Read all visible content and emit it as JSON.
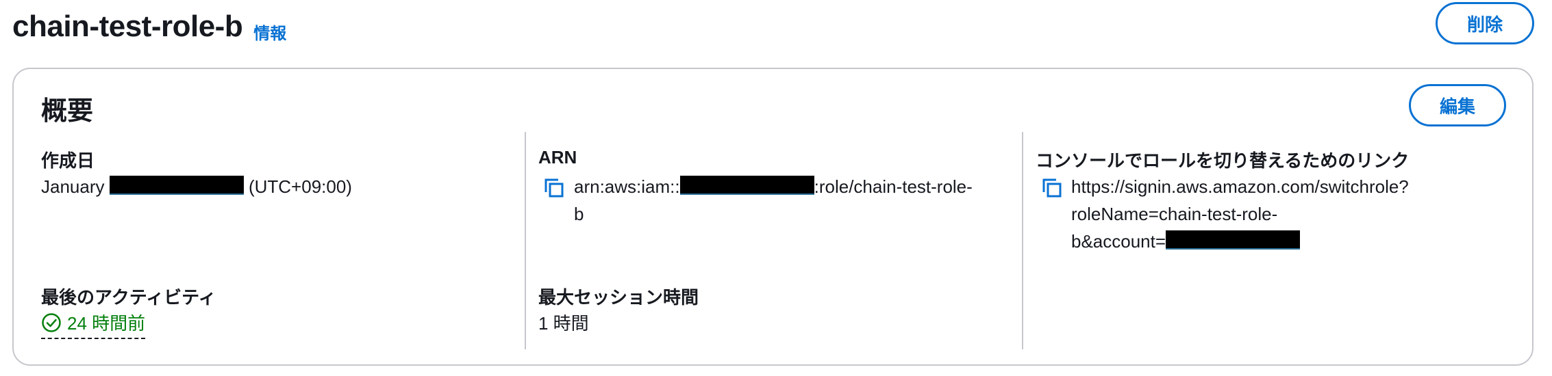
{
  "header": {
    "title": "chain-test-role-b",
    "info_link": "情報",
    "delete_button": "削除"
  },
  "summary": {
    "title": "概要",
    "edit_button": "編集",
    "created": {
      "label": "作成日",
      "value_prefix": "January",
      "value_suffix": "(UTC+09:00)"
    },
    "arn": {
      "label": "ARN",
      "value_prefix": "arn:aws:iam::",
      "value_suffix_line1": ":role/chain-test-role-",
      "value_suffix_line2": "b"
    },
    "switch_link": {
      "label": "コンソールでロールを切り替えるためのリンク",
      "line1": "https://signin.aws.amazon.com/switchrole?",
      "line2": "roleName=chain-test-role-",
      "line3": "b&account="
    },
    "last_activity": {
      "label": "最後のアクティビティ",
      "value": "24 時間前"
    },
    "max_session": {
      "label": "最大セッション時間",
      "value": "1 時間"
    }
  },
  "colors": {
    "accent": "#0972d3",
    "success": "#037f0c",
    "border": "#c6c6cd",
    "text": "#16191f"
  },
  "icons": [
    "copy-icon",
    "check-circle-icon"
  ]
}
